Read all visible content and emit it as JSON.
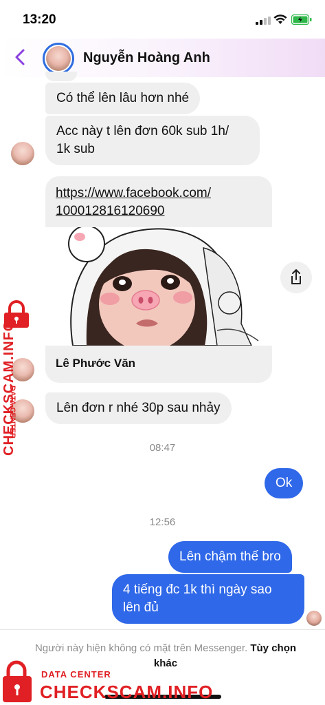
{
  "status_bar": {
    "time": "13:20"
  },
  "header": {
    "contact_name": "Nguyễn Hoàng Anh"
  },
  "messages": {
    "in_1": "Có thể lên lâu hơn nhé",
    "in_2_line1": "Acc này t lên đơn 60k sub 1h/",
    "in_2_line2": "1k sub",
    "link_line1": "https://www.facebook.com/",
    "link_line2": "100012816120690",
    "link_title": "Lê Phước Văn",
    "in_3": "Lên đơn r nhé 30p sau nhảy",
    "time_1": "08:47",
    "out_1": "Ok",
    "time_2": "12:56",
    "out_2": "Lên chậm thế bro",
    "out_3_line1": "4 tiếng đc 1k thì ngày sao",
    "out_3_line2": "lên đủ"
  },
  "footer": {
    "notice": "Người này hiện không có mặt trên Messenger.",
    "options_link": "Tùy chọn khác"
  },
  "watermark": {
    "label": "DATA CENTER",
    "brand": "CHECKSCAM.INFO"
  },
  "colors": {
    "outgoing_bubble": "#2f68e8",
    "incoming_bubble": "#efefef",
    "back_arrow": "#8a3fe0",
    "avatar_ring": "#2f6ee0",
    "watermark_red": "#e02024"
  },
  "icons": [
    "back-arrow-icon",
    "signal-icon",
    "wifi-icon",
    "battery-icon",
    "share-icon"
  ]
}
